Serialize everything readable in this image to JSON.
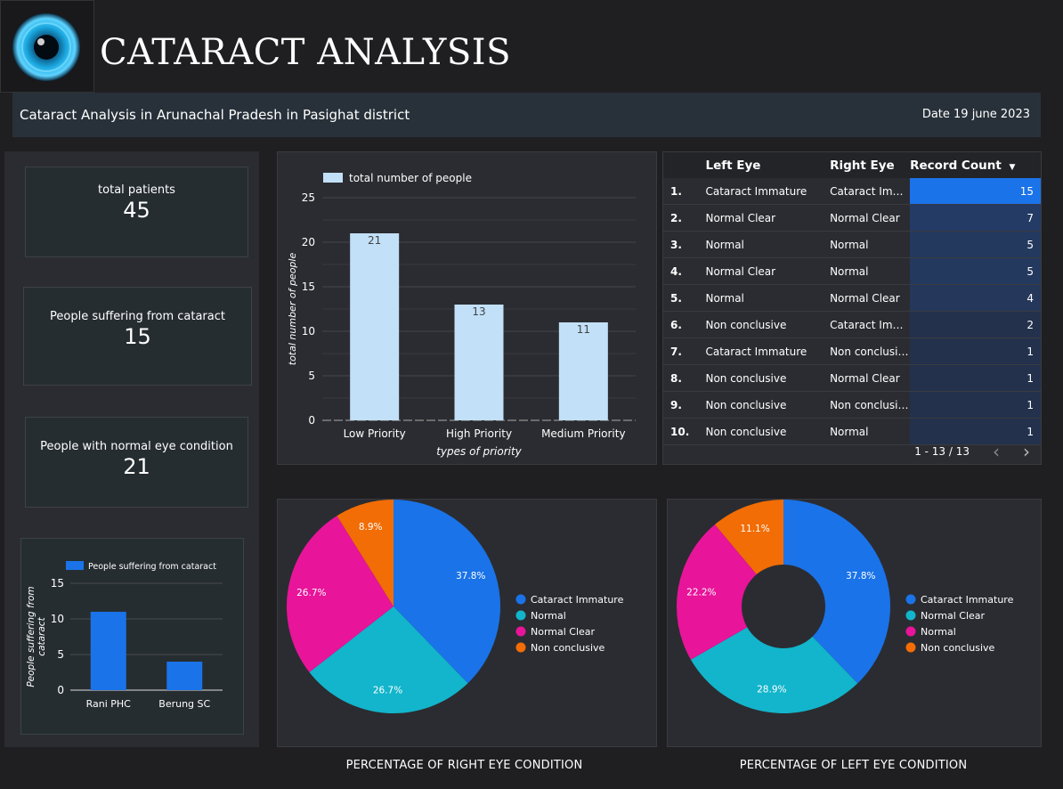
{
  "header": {
    "title": "CATARACT ANALYSIS",
    "subtitle": "Cataract Analysis in Arunachal Pradesh in Pasighat district",
    "date": "Date 19 june 2023"
  },
  "kpis": [
    {
      "label": "total patients",
      "value": "45"
    },
    {
      "label": "People suffering from cataract",
      "value": "15"
    },
    {
      "label": "People with normal eye condition",
      "value": "21"
    }
  ],
  "colors": {
    "background": "#1f1f22",
    "panel": "#2b2c31",
    "bar_light": "#c2e0f8",
    "bar_blue": "#1a73e8",
    "cataract_immature": "#1a73e8",
    "normal": "#12b5cb",
    "normal_clear": "#e8149a",
    "non_conclusive": "#f26d05"
  },
  "chart_data": [
    {
      "type": "bar",
      "legend": "total number of people",
      "categories": [
        "Low Priority",
        "High Priority",
        "Medium Priority"
      ],
      "values": [
        21,
        13,
        11
      ],
      "xlabel": "types of priority",
      "ylabel": "total number of people",
      "ylim": [
        0,
        25
      ],
      "yticks": [
        0,
        5,
        10,
        15,
        20,
        25
      ],
      "data_labels": true,
      "grid": true
    },
    {
      "type": "bar",
      "legend": "People suffering from cataract",
      "categories": [
        "Rani PHC",
        "Berung SC"
      ],
      "values": [
        11,
        4
      ],
      "ylabel": "People suffering from cataract",
      "ylim": [
        0,
        15
      ],
      "yticks": [
        0,
        5,
        10,
        15
      ],
      "grid": true
    },
    {
      "type": "table",
      "columns": [
        "Left Eye",
        "Right Eye",
        "Record Count"
      ],
      "sort": "Record Count descending",
      "rows": [
        {
          "rank": "1.",
          "left": "Cataract Immature",
          "right": "Cataract Im…",
          "count": 15
        },
        {
          "rank": "2.",
          "left": "Normal Clear",
          "right": "Normal Clear",
          "count": 7
        },
        {
          "rank": "3.",
          "left": "Normal",
          "right": "Normal",
          "count": 5
        },
        {
          "rank": "4.",
          "left": "Normal Clear",
          "right": "Normal",
          "count": 5
        },
        {
          "rank": "5.",
          "left": "Normal",
          "right": "Normal Clear",
          "count": 4
        },
        {
          "rank": "6.",
          "left": "Non conclusive",
          "right": "Cataract Im…",
          "count": 2
        },
        {
          "rank": "7.",
          "left": "Cataract Immature",
          "right": "Non conclusive",
          "count": 1
        },
        {
          "rank": "8.",
          "left": "Non conclusive",
          "right": "Normal Clear",
          "count": 1
        },
        {
          "rank": "9.",
          "left": "Non conclusive",
          "right": "Non conclusive",
          "count": 1
        },
        {
          "rank": "10.",
          "left": "Non conclusive",
          "right": "Normal",
          "count": 1
        }
      ],
      "pagination": "1 - 13 / 13"
    },
    {
      "type": "pie",
      "title": "PERCENTAGE OF RIGHT EYE CONDITION",
      "donut": false,
      "slices": [
        {
          "name": "Cataract Immature",
          "value": 37.8,
          "label": "37.8%",
          "color": "#1a73e8"
        },
        {
          "name": "Normal",
          "value": 26.7,
          "label": "26.7%",
          "color": "#12b5cb"
        },
        {
          "name": "Normal Clear",
          "value": 26.7,
          "label": "26.7%",
          "color": "#e8149a"
        },
        {
          "name": "Non conclusive",
          "value": 8.9,
          "label": "8.9%",
          "color": "#f26d05"
        }
      ],
      "legend_position": "right"
    },
    {
      "type": "pie",
      "title": "PERCENTAGE OF LEFT EYE CONDITION",
      "donut": true,
      "slices": [
        {
          "name": "Cataract Immature",
          "value": 37.8,
          "label": "37.8%",
          "color": "#1a73e8"
        },
        {
          "name": "Normal Clear",
          "value": 28.9,
          "label": "28.9%",
          "color": "#12b5cb"
        },
        {
          "name": "Normal",
          "value": 22.2,
          "label": "22.2%",
          "color": "#e8149a"
        },
        {
          "name": "Non conclusive",
          "value": 11.1,
          "label": "11.1%",
          "color": "#f26d05"
        }
      ],
      "legend_position": "right"
    }
  ]
}
